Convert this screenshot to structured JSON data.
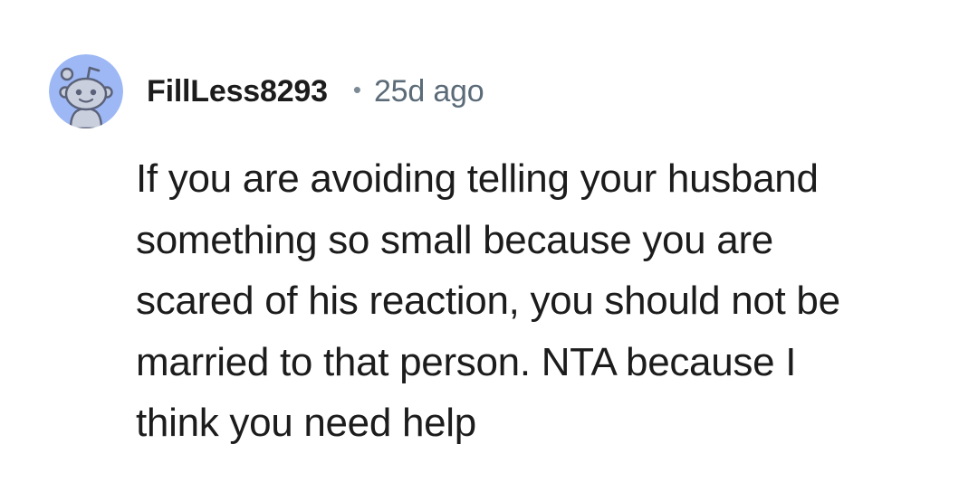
{
  "comment": {
    "author": "FillLess8293",
    "separator": "•",
    "timestamp": "25d ago",
    "avatar_icon": "snoo-avatar-icon",
    "avatar_bg_color": "#9db8f5",
    "body_lines": [
      "If you are avoiding telling your husband",
      "something so small because you are",
      "scared of his reaction, you should not be",
      "married to that person. NTA because I",
      "think you need help"
    ]
  }
}
